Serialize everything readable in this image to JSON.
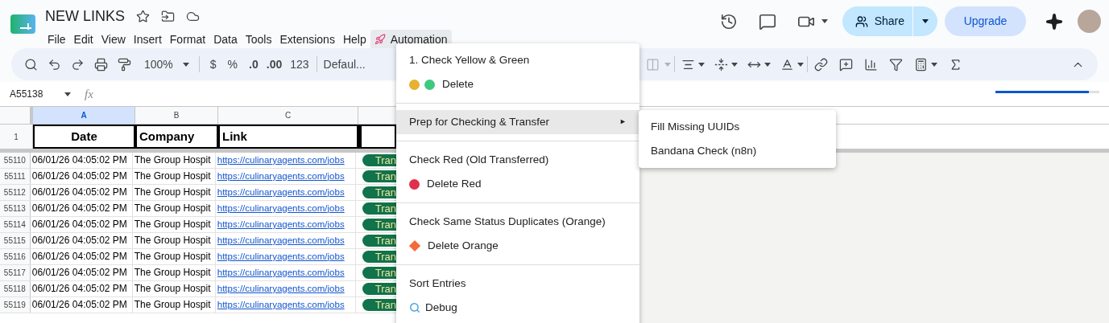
{
  "document": {
    "title": "NEW LINKS"
  },
  "menu_bar": [
    {
      "label": "File",
      "kind": "plain",
      "selected": false
    },
    {
      "label": "Edit",
      "kind": "plain",
      "selected": false
    },
    {
      "label": "View",
      "kind": "plain",
      "selected": false
    },
    {
      "label": "Insert",
      "kind": "plain",
      "selected": false
    },
    {
      "label": "Format",
      "kind": "plain",
      "selected": false
    },
    {
      "label": "Data",
      "kind": "plain",
      "selected": false
    },
    {
      "label": "Tools",
      "kind": "plain",
      "selected": false
    },
    {
      "label": "Extensions",
      "kind": "plain",
      "selected": false
    },
    {
      "label": "Help",
      "kind": "plain",
      "selected": false
    },
    {
      "label": "Automation",
      "kind": "custom",
      "selected": true
    }
  ],
  "header_actions": {
    "share": "Share",
    "upgrade": "Upgrade"
  },
  "toolbar": {
    "zoom": "100%",
    "currency": "$",
    "percent": "%",
    "decrease_decimal": ".0",
    "increase_decimal": ".00",
    "number_format": "123",
    "font": "Defaul..."
  },
  "formula_bar": {
    "name_box": "A55138",
    "function_label": "fx"
  },
  "loading": {
    "level": 0.9
  },
  "sheet": {
    "columns": [
      {
        "label": "A",
        "selected": true
      },
      {
        "label": "B",
        "selected": false
      },
      {
        "label": "C",
        "selected": false
      }
    ],
    "header_row": {
      "number": "1",
      "cells": [
        "Date",
        "Company",
        "Link"
      ]
    },
    "rows": [
      {
        "number": "55110",
        "date": "06/01/26 04:05:02 PM",
        "company": "The Group Hospit",
        "link": "https://culinaryagents.com/jobs",
        "status": "Tran"
      },
      {
        "number": "55111",
        "date": "06/01/26 04:05:02 PM",
        "company": "The Group Hospit",
        "link": "https://culinaryagents.com/jobs",
        "status": "Tran"
      },
      {
        "number": "55112",
        "date": "06/01/26 04:05:02 PM",
        "company": "The Group Hospit",
        "link": "https://culinaryagents.com/jobs",
        "status": "Tran"
      },
      {
        "number": "55113",
        "date": "06/01/26 04:05:02 PM",
        "company": "The Group Hospit",
        "link": "https://culinaryagents.com/jobs",
        "status": "Tran"
      },
      {
        "number": "55114",
        "date": "06/01/26 04:05:02 PM",
        "company": "The Group Hospit",
        "link": "https://culinaryagents.com/jobs",
        "status": "Tran"
      },
      {
        "number": "55115",
        "date": "06/01/26 04:05:02 PM",
        "company": "The Group Hospit",
        "link": "https://culinaryagents.com/jobs",
        "status": "Tran"
      },
      {
        "number": "55116",
        "date": "06/01/26 04:05:02 PM",
        "company": "The Group Hospit",
        "link": "https://culinaryagents.com/jobs",
        "status": "Tran"
      },
      {
        "number": "55117",
        "date": "06/01/26 04:05:02 PM",
        "company": "The Group Hospit",
        "link": "https://culinaryagents.com/jobs",
        "status": "Tran"
      },
      {
        "number": "55118",
        "date": "06/01/26 04:05:02 PM",
        "company": "The Group Hospit",
        "link": "https://culinaryagents.com/jobs",
        "status": "Tran"
      },
      {
        "number": "55119",
        "date": "06/01/26 04:05:02 PM",
        "company": "The Group Hospit",
        "link": "https://culinaryagents.com/jobs",
        "status": "Tran"
      }
    ]
  },
  "automation_menu": {
    "sections": [
      {
        "items": [
          {
            "label": "1. Check Yellow & Green",
            "kind": "plain"
          },
          {
            "label": "Delete",
            "kind": "marks",
            "marks": [
              {
                "kind": "circle",
                "color": "#e5b231"
              },
              {
                "kind": "circle",
                "color": "#3ec97e"
              }
            ]
          }
        ]
      },
      {
        "items": [
          {
            "label": "Prep for Checking & Transfer",
            "kind": "submenu",
            "selected": true,
            "arrow": "►"
          }
        ]
      },
      {
        "items": [
          {
            "label": "Check Red (Old Transferred)",
            "kind": "plain"
          },
          {
            "label": "Delete Red",
            "kind": "marks",
            "marks": [
              {
                "kind": "circle",
                "color": "#e0304e"
              }
            ]
          }
        ]
      },
      {
        "items": [
          {
            "label": "Check Same Status Duplicates (Orange)",
            "kind": "plain"
          },
          {
            "label": "Delete Orange",
            "kind": "marks",
            "marks": [
              {
                "kind": "diamond",
                "color": "#f26b3a"
              }
            ]
          }
        ]
      },
      {
        "items": [
          {
            "label": "Sort Entries",
            "kind": "plain"
          },
          {
            "label": "Debug",
            "kind": "magnifier"
          }
        ]
      }
    ]
  },
  "submenu": {
    "items": [
      "Fill Missing UUIDs",
      "Bandana Check (n8n)"
    ]
  }
}
